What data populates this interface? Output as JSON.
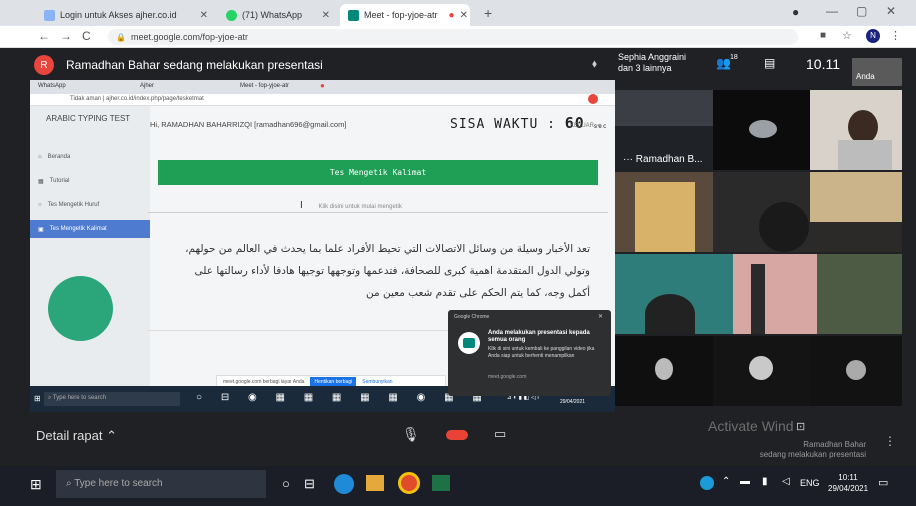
{
  "browser": {
    "tabs": [
      {
        "label": "Login untuk Akses ajher.co.id"
      },
      {
        "label": "(71) WhatsApp"
      },
      {
        "label": "Meet - fop-yjoe-atr"
      }
    ],
    "url": "meet.google.com/fop-yjoe-atr"
  },
  "meet": {
    "presenting_text": "Ramadhan Bahar sedang melakukan presentasi",
    "presenter_initial": "R",
    "participants_label": "Sephia Anggraini\ndan 3 lainnya",
    "participant_count": "18",
    "clock": "10.11",
    "self_label": "Anda",
    "tile_name": "Ramadhan B...",
    "meeting_details": "Detail rapat",
    "bottom_right_name": "Ramadhan Bahar",
    "bottom_right_status": "sedang melakukan presentasi",
    "activate_windows": "Activate Wind"
  },
  "shared": {
    "inner_tabs": [
      "WhatsApp",
      "Ajher",
      "Meet - fop-yjoe-atr"
    ],
    "inner_url": "Tidak aman | ajher.co.id/index.php/page/tesketmat",
    "app_title": "ARABIC TYPING TEST",
    "greeting": "Hi, RAMADHAN BAHARRIZQI [ramadhan696@gmail.com]",
    "timer_label": "SISA WAKTU :",
    "timer_value": "60",
    "timer_unit": "sec",
    "logout": "KELUAR",
    "sidebar_items": [
      "Beranda",
      "Tutorial",
      "Tes Mengetik Huruf",
      "Tes Mengetik Kalimat"
    ],
    "banner": "Tes Mengetik Kalimat",
    "input_hint": "Klik disini untuk mulai mengetik",
    "arabic_text": "تعد الأخبار وسيلة من وسائل الاتصالات التي تحيط الأفراد علما بما يحدث في العالم من حولهم، وتولي الدول المتقدمة اهمية كبرى للصحافة، فتدعمها وتوجهها توجيها هادفا لأداء رسالتها على أكمل وجه، كما يتم الحكم على تقدم شعب معين من",
    "share_bar_text": "meet.google.com berbagi layar Anda",
    "share_stop": "Hentikan berbagi",
    "share_hide": "Sembunyikan",
    "search_inner": "Type here to search",
    "inner_time": "10:11",
    "inner_date": "29/04/2021"
  },
  "notification": {
    "source": "Google Chrome",
    "title": "Anda melakukan presentasi kepada semua orang",
    "body": "Klik di sini untuk kembali ke panggilan video jika Anda siap untuk berhenti menampilkan",
    "link": "meet.google.com"
  },
  "windows": {
    "search_placeholder": "Type here to search",
    "language": "ENG",
    "time": "10:11",
    "date": "29/04/2021"
  },
  "colors": {
    "meet_bg": "#202124",
    "banner_green": "#1e9f55",
    "end_call_red": "#ea4335"
  }
}
